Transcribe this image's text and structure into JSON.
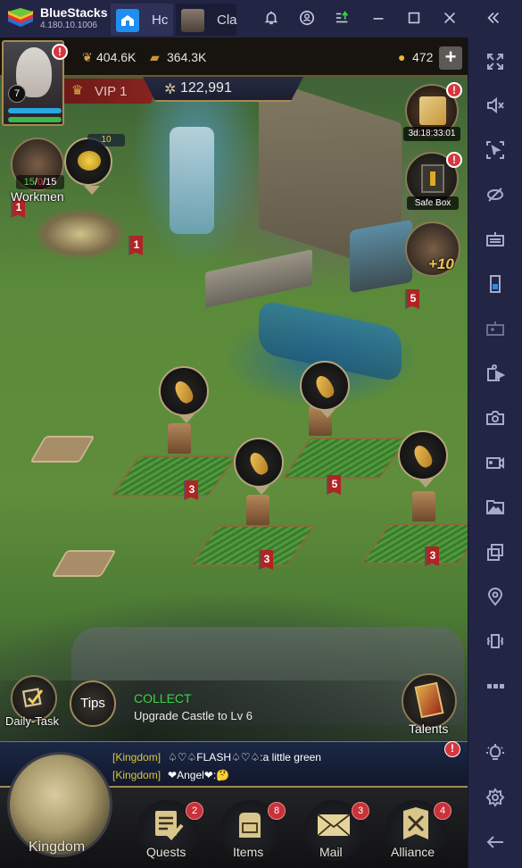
{
  "window": {
    "app_name": "BlueStacks",
    "version": "4.180.10.1006",
    "tabs": [
      {
        "label": "Hc",
        "icon": "home-icon"
      },
      {
        "label": "Cla",
        "icon": "game-thumbnail-icon"
      }
    ],
    "controls": [
      "bell-icon",
      "account-icon",
      "updates-icon",
      "minimize-icon",
      "maximize-icon",
      "close-icon",
      "collapse-sidebar-icon"
    ]
  },
  "sidebar": {
    "items": [
      {
        "name": "fullscreen-icon"
      },
      {
        "name": "mute-icon"
      },
      {
        "name": "pointer-lock-icon"
      },
      {
        "name": "visibility-off-icon"
      },
      {
        "name": "keyboard-icon"
      },
      {
        "name": "phone-portrait-icon"
      },
      {
        "name": "gamepad-icon"
      },
      {
        "name": "media-import-icon"
      },
      {
        "name": "screenshot-icon"
      },
      {
        "name": "record-icon"
      },
      {
        "name": "media-folder-icon"
      },
      {
        "name": "multi-instance-icon"
      },
      {
        "name": "location-icon"
      },
      {
        "name": "shake-icon"
      },
      {
        "name": "more-icon"
      },
      {
        "name": "brightness-icon"
      },
      {
        "name": "settings-icon"
      },
      {
        "name": "back-icon"
      }
    ]
  },
  "game": {
    "player": {
      "level": "7",
      "vip": "VIP 1",
      "power": "122,991"
    },
    "resources": {
      "food": "404.6K",
      "wood": "364.3K",
      "gold": "472"
    },
    "workmen": {
      "label": "Workmen",
      "available": "15",
      "busy": "0",
      "total": "15"
    },
    "coin_pile": "10",
    "event_timer": "3d:18:33:01",
    "safe_box": "Safe Box",
    "hero_bonus": "+10",
    "building_levels": [
      "1",
      "1",
      "5",
      "3",
      "5",
      "3",
      "3"
    ],
    "daily_task": "Daily-Task",
    "tips": "Tips",
    "collect_title": "COLLECT",
    "collect_text": "Upgrade Castle to Lv 6",
    "talents": "Talents",
    "chat": [
      {
        "channel": "[Kingdom]",
        "text": "♤♡♤FLASH♤♡♤:a little green"
      },
      {
        "channel": "[Kingdom]",
        "text": "❤Angel❤:🤔"
      }
    ],
    "nav": [
      {
        "label": "Kingdom",
        "badge": null
      },
      {
        "label": "Quests",
        "badge": "2"
      },
      {
        "label": "Items",
        "badge": "8"
      },
      {
        "label": "Mail",
        "badge": "3"
      },
      {
        "label": "Alliance",
        "badge": "4"
      }
    ],
    "colors": {
      "collect_green": "#3ad24a",
      "chat_channel": "#d8c83a",
      "badge_red": "#c8323a",
      "workmen_busy": "#e03030",
      "workmen_available": "#4fd04f"
    }
  }
}
